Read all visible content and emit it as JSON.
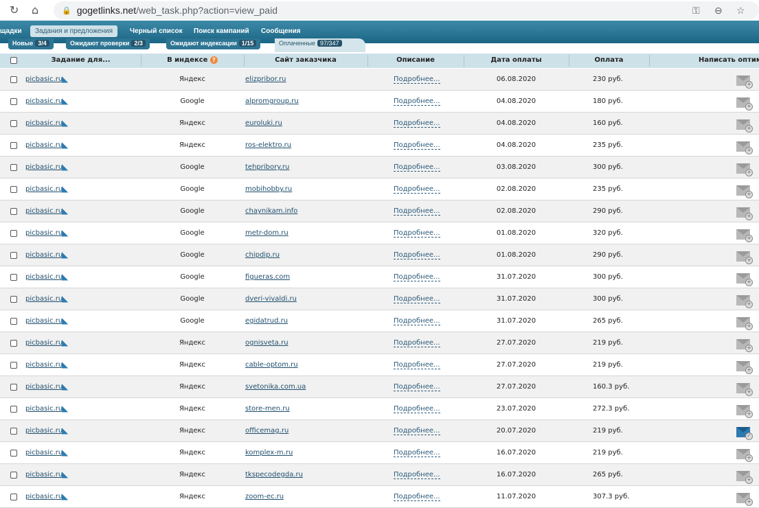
{
  "browser": {
    "url_host": "gogetlinks.net",
    "url_path": "/web_task.php?action=view_paid"
  },
  "nav": {
    "items": [
      "щадки",
      "Задания и предложения",
      "Черный список",
      "Поиск кампаний",
      "Сообщения"
    ]
  },
  "subtabs": [
    {
      "label": "Новые",
      "count": "3/4"
    },
    {
      "label": "Ожидают проверки",
      "count": "2/3"
    },
    {
      "label": "Ожидают индексации",
      "count": "1/15"
    },
    {
      "label": "Оплаченные",
      "count": "97/347"
    }
  ],
  "columns": {
    "task": "Задание для...",
    "index": "В индексе",
    "site": "Сайт заказчика",
    "desc": "Описание",
    "date": "Дата оплаты",
    "pay": "Оплата",
    "write": "Написать оптим"
  },
  "rows": [
    {
      "task": "picbasic.ru",
      "index": "Яндекс",
      "site": "elizpribor.ru",
      "desc": "Подробнее...",
      "date": "06.08.2020",
      "pay": "230 руб."
    },
    {
      "task": "picbasic.ru",
      "index": "Google",
      "site": "alpromgroup.ru",
      "desc": "Подробнее...",
      "date": "04.08.2020",
      "pay": "180 руб."
    },
    {
      "task": "picbasic.ru",
      "index": "Яндекс",
      "site": "euroluki.ru",
      "desc": "Подробнее...",
      "date": "04.08.2020",
      "pay": "160 руб."
    },
    {
      "task": "picbasic.ru",
      "index": "Яндекс",
      "site": "ros-elektro.ru",
      "desc": "Подробнее...",
      "date": "04.08.2020",
      "pay": "235 руб."
    },
    {
      "task": "picbasic.ru",
      "index": "Google",
      "site": "tehpribory.ru",
      "desc": "Подробнее...",
      "date": "03.08.2020",
      "pay": "300 руб."
    },
    {
      "task": "picbasic.ru",
      "index": "Google",
      "site": "mobihobby.ru",
      "desc": "Подробнее...",
      "date": "02.08.2020",
      "pay": "235 руб."
    },
    {
      "task": "picbasic.ru",
      "index": "Google",
      "site": "chaynikam.info",
      "desc": "Подробнее...",
      "date": "02.08.2020",
      "pay": "290 руб."
    },
    {
      "task": "picbasic.ru",
      "index": "Google",
      "site": "metr-dom.ru",
      "desc": "Подробнее...",
      "date": "01.08.2020",
      "pay": "320 руб."
    },
    {
      "task": "picbasic.ru",
      "index": "Google",
      "site": "chipdip.ru",
      "desc": "Подробнее...",
      "date": "01.08.2020",
      "pay": "290 руб."
    },
    {
      "task": "picbasic.ru",
      "index": "Google",
      "site": "figueras.com",
      "desc": "Подробнее...",
      "date": "31.07.2020",
      "pay": "300 руб."
    },
    {
      "task": "picbasic.ru",
      "index": "Google",
      "site": "dveri-vivaldi.ru",
      "desc": "Подробнее...",
      "date": "31.07.2020",
      "pay": "300 руб."
    },
    {
      "task": "picbasic.ru",
      "index": "Google",
      "site": "egidatrud.ru",
      "desc": "Подробнее...",
      "date": "31.07.2020",
      "pay": "265 руб."
    },
    {
      "task": "picbasic.ru",
      "index": "Яндекс",
      "site": "ognisveta.ru",
      "desc": "Подробнее...",
      "date": "27.07.2020",
      "pay": "219 руб."
    },
    {
      "task": "picbasic.ru",
      "index": "Яндекс",
      "site": "cable-optom.ru",
      "desc": "Подробнее...",
      "date": "27.07.2020",
      "pay": "219 руб."
    },
    {
      "task": "picbasic.ru",
      "index": "Яндекс",
      "site": "svetonika.com.ua",
      "desc": "Подробнее...",
      "date": "27.07.2020",
      "pay": "160.3 руб."
    },
    {
      "task": "picbasic.ru",
      "index": "Яндекс",
      "site": "store-men.ru",
      "desc": "Подробнее...",
      "date": "23.07.2020",
      "pay": "272.3 руб."
    },
    {
      "task": "picbasic.ru",
      "index": "Яндекс",
      "site": "officemag.ru",
      "desc": "Подробнее...",
      "date": "20.07.2020",
      "pay": "219 руб.",
      "read": true
    },
    {
      "task": "picbasic.ru",
      "index": "Яндекс",
      "site": "komplex-m.ru",
      "desc": "Подробнее...",
      "date": "16.07.2020",
      "pay": "219 руб."
    },
    {
      "task": "picbasic.ru",
      "index": "Яндекс",
      "site": "tkspecodegda.ru",
      "desc": "Подробнее...",
      "date": "16.07.2020",
      "pay": "265 руб."
    },
    {
      "task": "picbasic.ru",
      "index": "Яндекс",
      "site": "zoom-ec.ru",
      "desc": "Подробнее...",
      "date": "11.07.2020",
      "pay": "307.3 руб."
    }
  ]
}
